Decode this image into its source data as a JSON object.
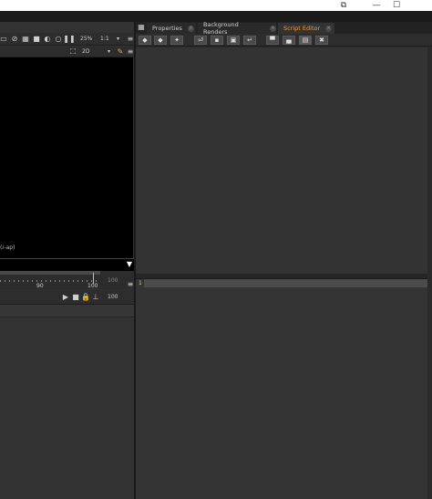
{
  "window": {
    "restore_glyph": "⧉",
    "minimize_glyph": "—",
    "maximize_glyph": "☐"
  },
  "viewer": {
    "zoom": "25%",
    "ratio": "1:1",
    "view_mode": "2D",
    "channel_label": "(ⅈ-ap)",
    "dropdown_glyph": "▾"
  },
  "timeline": {
    "tick_label_90": "90",
    "tick_label_100": "100",
    "frame_field": "100",
    "out_frame": "100"
  },
  "tabs": [
    {
      "label": "Properties",
      "active": false
    },
    {
      "label": "Background Renders",
      "active": false
    },
    {
      "label": "Script Editor",
      "active": true
    }
  ],
  "tab_close_glyph": "×",
  "script_editor": {
    "toolbar_icons": [
      "prev-script-icon",
      "next-script-icon",
      "clear-history-icon",
      "source-script-icon",
      "load-script-icon",
      "save-script-icon",
      "run-script-icon",
      "show-input-icon",
      "show-output-icon",
      "show-both-icon",
      "clear-output-icon"
    ],
    "input_line_number": "1"
  }
}
